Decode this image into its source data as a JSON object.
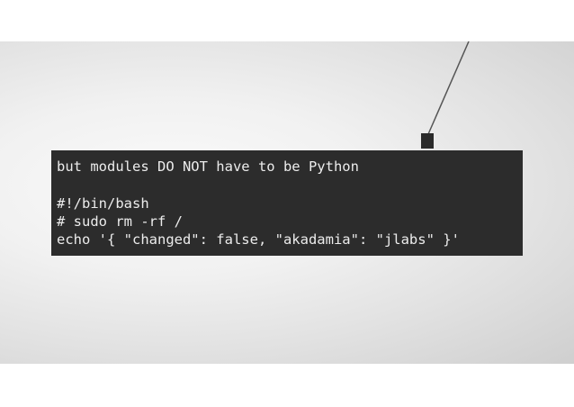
{
  "code": {
    "lines": [
      "but modules DO NOT have to be Python",
      "",
      "#!/bin/bash",
      "# sudo rm -rf /",
      "echo '{ \"changed\": false, \"akadamia\": \"jlabs\" }'"
    ]
  },
  "colors": {
    "code_background": "#2c2c2c",
    "code_text": "#ececec"
  },
  "icons": [
    "hanging-lamp-icon"
  ]
}
